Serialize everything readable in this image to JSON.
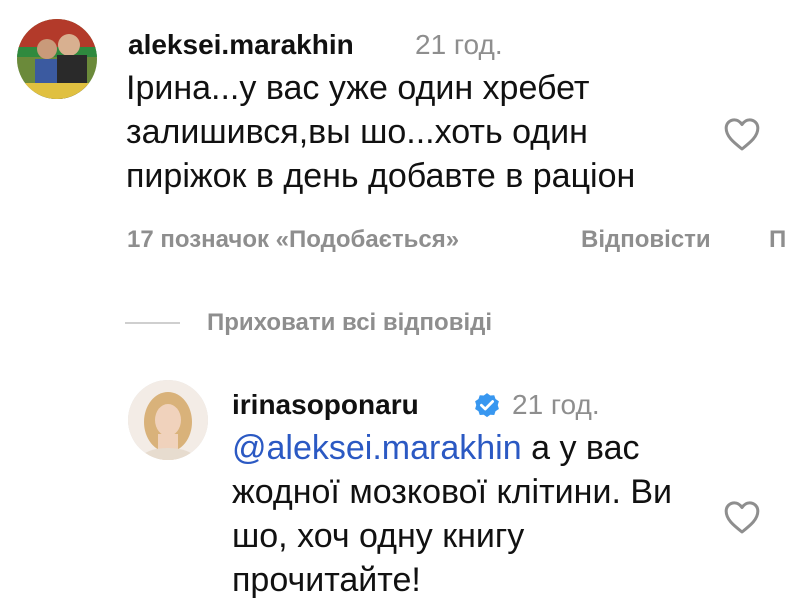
{
  "comment": {
    "username": "aleksei.marakhin",
    "time": "21 год.",
    "lines": [
      "Ірина...у вас уже один хребет",
      "залишився,вы шо...хоть один",
      "пиріжок в день добавте в раціон"
    ],
    "likes_label": "17 позначок «Подобається»",
    "reply_label": "Відповісти",
    "more_label": "П"
  },
  "replies_toggle": {
    "label": "Приховати всі відповіді"
  },
  "reply": {
    "username": "irinasoponaru",
    "verified_icon": "verified-badge-icon",
    "time": "21 год.",
    "mention": "@aleksei.marakhin",
    "first_line_rest": " а у вас",
    "lines": [
      "жодної мозкової клітини. Ви",
      "шо, хоч одну книгу",
      "прочитайте!"
    ]
  },
  "colors": {
    "mention": "#2b59c3",
    "verified": "#3897f0",
    "muted": "#8e8e8e"
  }
}
